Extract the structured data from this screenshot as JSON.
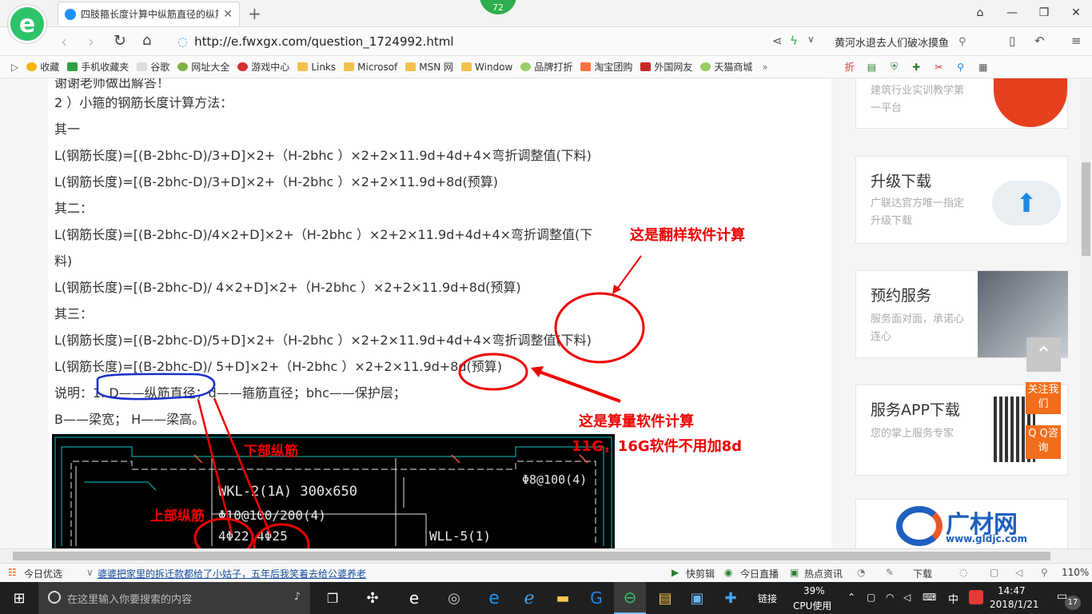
{
  "browser": {
    "tab_title": "四肢箍长度计算中纵筋直径的纵筋",
    "badge": "72",
    "url": "http://e.fwxgx.com/question_1724992.html",
    "search_text": "黄河水退去人们破冰摸鱼"
  },
  "bookmarks": [
    "收藏",
    "手机收藏夹",
    "谷歌",
    "网址大全",
    "游戏中心",
    "Links",
    "Microsof",
    "MSN 网",
    "Window",
    "品牌打折",
    "淘宝团购",
    "外国网友",
    "天猫商城"
  ],
  "article": {
    "lines": [
      "谢谢老师做出解答！",
      "2 ）小箍的钢筋长度计算方法：",
      "其一",
      "L(钢筋长度)=[(B-2bhc-D)/3+D]×2+（H-2bhc ）×2+2×11.9d+4d+4×弯折调整值(下料)",
      "L(钢筋长度)=[(B-2bhc-D)/3+D]×2+（H-2bhc ）×2+2×11.9d+8d(预算)",
      "其二：",
      "L(钢筋长度)=[(B-2bhc-D)/4×2+D]×2+（H-2bhc ）×2+2×11.9d+4d+4×弯折调整值(下",
      "料)",
      "L(钢筋长度)=[(B-2bhc-D)/ 4×2+D]×2+（H-2bhc ）×2+2×11.9d+8d(预算)",
      "其三：",
      "L(钢筋长度)=[(B-2bhc-D)/5+D]×2+（H-2bhc ）×2+2×11.9d+4d+4×弯折调整值(下料)",
      "L(钢筋长度)=[(B-2bhc-D)/ 5+D]×2+（H-2bhc ）×2+2×11.9d+8d(预算)",
      "说明：1. D——纵筋直径；d——箍筋直径；bhc——保护层；",
      "B——梁宽； H——梁高。"
    ],
    "annotations": {
      "fanyang": "这是翻样软件计算",
      "suanliang": "这是算量软件计算",
      "no8d": "11G，16G软件不用加8d",
      "lower_bar": "下部纵筋",
      "upper_bar": "上部纵筋"
    },
    "cad": {
      "beam": "WKL-2(1A) 300x650",
      "stirrup": "Φ10@100/200(4)",
      "bars": "4Φ22;4Φ25",
      "right_stirrup": "Φ8@100(4)",
      "wall": "WLL-5(1)"
    }
  },
  "sidebar": {
    "card1_sub": "建筑行业实训教学第一平台",
    "card2_title": "升级下载",
    "card2_sub": "广联达官方唯一指定升级下载",
    "card3_title": "预约服务",
    "card3_sub": "服务面对面，承诺心连心",
    "card4_title": "服务APP下载",
    "card4_sub": "您的掌上服务专家",
    "brand": "广材网",
    "brand_url": "www.gldjc.com",
    "follow_btn": "关注我们",
    "qq_btn": "Q Q咨询"
  },
  "statusbar": {
    "today": "今日优选",
    "news": "婆婆把家里的拆迁款都给了小姑子，五年后我笑着去给公婆养老",
    "kuaijianji": "快剪辑",
    "live": "今日直播",
    "hot": "热点资讯",
    "download": "下载",
    "zoom": "110%"
  },
  "taskbar": {
    "search_placeholder": "在这里输入你要搜索的内容",
    "links": "链接",
    "cpu": "39%",
    "cpu_label": "CPU使用",
    "ime": "中",
    "time": "14:47",
    "date": "2018/1/21",
    "notif": "17"
  }
}
